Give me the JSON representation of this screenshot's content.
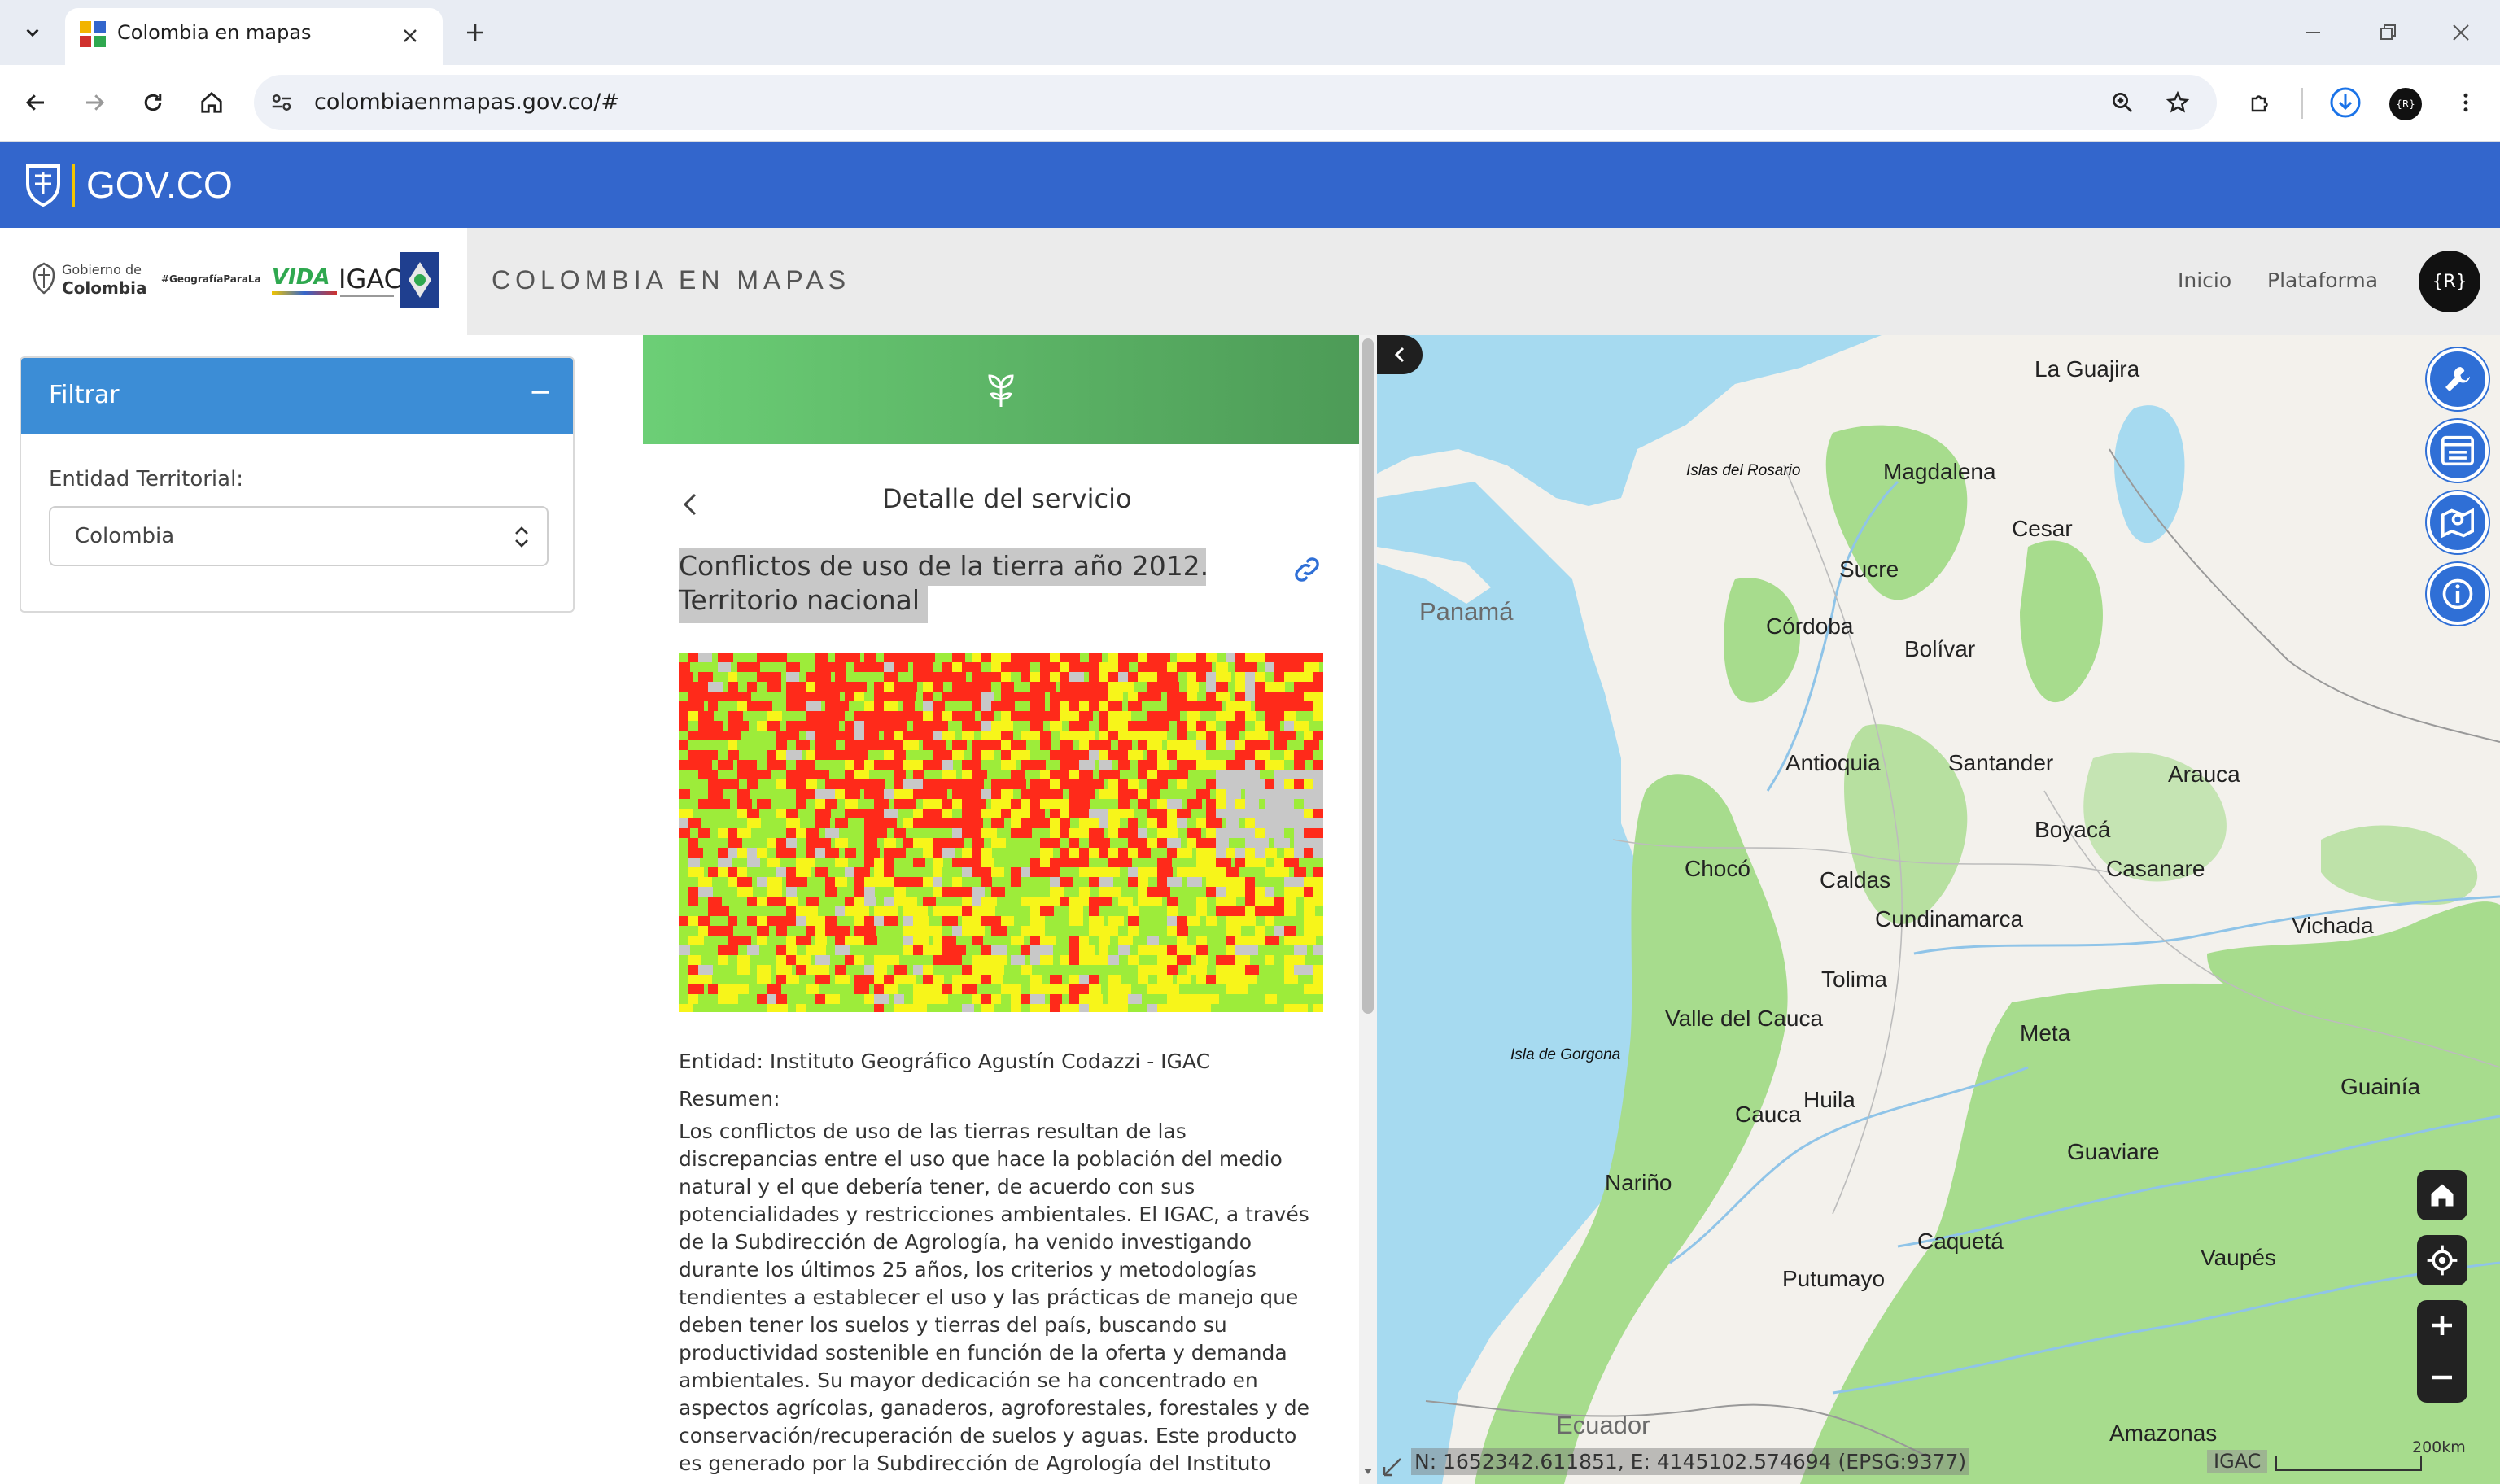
{
  "browser": {
    "tab_title": "Colombia en mapas",
    "url": "colombiaenmapas.gov.co/#",
    "profile_initial": "{R}"
  },
  "gov_bar": {
    "brand": "GOV.CO"
  },
  "header": {
    "logo_gobierno_line1": "Gobierno de",
    "logo_gobierno_line2": "Colombia",
    "logo_hashtag": "#GeografíaParaLa",
    "logo_vida": "VIDA",
    "logo_igac": "IGAC",
    "site_title": "COLOMBIA EN MAPAS",
    "nav": [
      "Inicio",
      "Plataforma"
    ],
    "user_initial": "{R}"
  },
  "filter": {
    "title": "Filtrar",
    "collapse_symbol": "−",
    "field_label": "Entidad Territorial:",
    "selected": "Colombia"
  },
  "detail": {
    "heading": "Detalle del servicio",
    "service_title_line1": "Conflictos de uso de la tierra año 2012.",
    "service_title_line2": "Territorio nacional",
    "entity": "Entidad: Instituto Geográfico Agustín Codazzi - IGAC",
    "summary_label": "Resumen:",
    "summary_lines": [
      "Los conflictos de uso de las tierras resultan de las",
      "discrepancias entre el uso que hace la población del medio",
      "natural y el que debería tener, de acuerdo con sus",
      "potencialidades y restricciones ambientales. El IGAC, a través",
      "de la Subdirección de Agrología, ha venido investigando",
      "durante los últimos 25 años, los criterios y metodologías",
      "tendientes a establecer el uso y las prácticas de manejo que",
      "deben tener los suelos y tierras del país, buscando su",
      "productividad sostenible en función de la oferta y demanda",
      "ambientales. Su mayor dedicación se ha concentrado en",
      "aspectos agrícolas, ganaderos, agroforestales, forestales y de",
      "conservación/recuperación de suelos y aguas. Este producto",
      "es generado por la Subdirección de Agrología del Instituto"
    ]
  },
  "map": {
    "departments": [
      "La Guajira",
      "Magdalena",
      "Cesar",
      "Sucre",
      "Córdoba",
      "Bolívar",
      "Antioquia",
      "Santander",
      "Arauca",
      "Boyacá",
      "Casanare",
      "Chocó",
      "Caldas",
      "Cundinamarca",
      "Vichada",
      "Tolima",
      "Valle del Cauca",
      "Meta",
      "Guainía",
      "Cauca",
      "Huila",
      "Guaviare",
      "Nariño",
      "Caquetá",
      "Vaupés",
      "Putumayo",
      "Amazonas"
    ],
    "islands": [
      "Islas del Rosario",
      "Isla de Gorgona"
    ],
    "countries": [
      "Panamá",
      "Ecuador"
    ],
    "coordinates": "N: 1652342.611851, E: 4145102.574694 (EPSG:9377)",
    "attribution": "IGAC",
    "scale_label": "200km",
    "colors": {
      "water": "#a6daf0",
      "land": "#f3f1ec",
      "forest": "#a7dc8d",
      "accent": "#2f6fd6"
    }
  },
  "thumbnail_colors": {
    "red": "#ff2a1a",
    "green": "#9dec3a",
    "yellow": "#f7f51a",
    "gray": "#c8c8c8"
  }
}
